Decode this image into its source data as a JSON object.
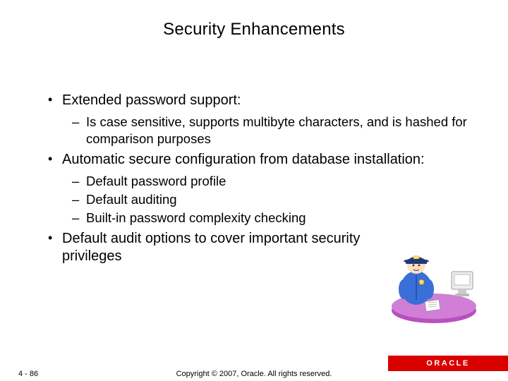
{
  "title": "Security Enhancements",
  "bullets": [
    {
      "text": "Extended password support:",
      "sub": [
        "Is case sensitive, supports multibyte characters, and is hashed for comparison purposes"
      ]
    },
    {
      "text": "Automatic secure configuration from database installation:",
      "sub": [
        "Default password profile",
        "Default auditing",
        "Built-in password complexity checking"
      ]
    },
    {
      "text": "Default audit options to cover important security privileges",
      "sub": []
    }
  ],
  "footer": {
    "page": "4 - 86",
    "copyright": "Copyright © 2007, Oracle. All rights reserved.",
    "brand": "ORACLE"
  }
}
